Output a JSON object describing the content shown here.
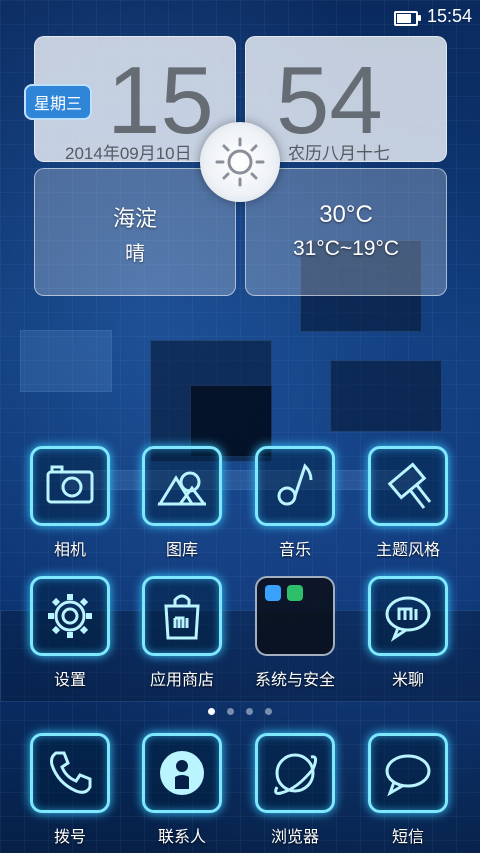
{
  "status_bar": {
    "time": "15:54",
    "battery_level": 0.85
  },
  "widget": {
    "hour": "15",
    "minute": "54",
    "date": "2014年09月10日",
    "lunar_date": "农历八月十七",
    "weekday": "星期三",
    "location": "海淀",
    "condition": "晴",
    "temperature": "30°C",
    "temp_range": "31°C~19°C",
    "weather_icon": "sun-icon"
  },
  "apps_row1": [
    {
      "label": "相机",
      "icon": "camera-icon"
    },
    {
      "label": "图库",
      "icon": "gallery-icon"
    },
    {
      "label": "音乐",
      "icon": "music-note-icon"
    },
    {
      "label": "主题风格",
      "icon": "paint-roller-icon"
    }
  ],
  "apps_row2": [
    {
      "label": "设置",
      "icon": "gear-icon"
    },
    {
      "label": "应用商店",
      "icon": "shopping-bag-icon"
    },
    {
      "label": "系统与安全",
      "icon": "folder-icon"
    },
    {
      "label": "米聊",
      "icon": "chat-mi-icon"
    }
  ],
  "page_indicator": {
    "pages": 4,
    "current": 1
  },
  "dock": [
    {
      "label": "拨号",
      "icon": "phone-icon"
    },
    {
      "label": "联系人",
      "icon": "contact-icon"
    },
    {
      "label": "浏览器",
      "icon": "browser-planet-icon"
    },
    {
      "label": "短信",
      "icon": "message-bubble-icon"
    }
  ],
  "colors": {
    "neon": "#7fe8ff",
    "weekday_badge": "#2f86d8"
  }
}
